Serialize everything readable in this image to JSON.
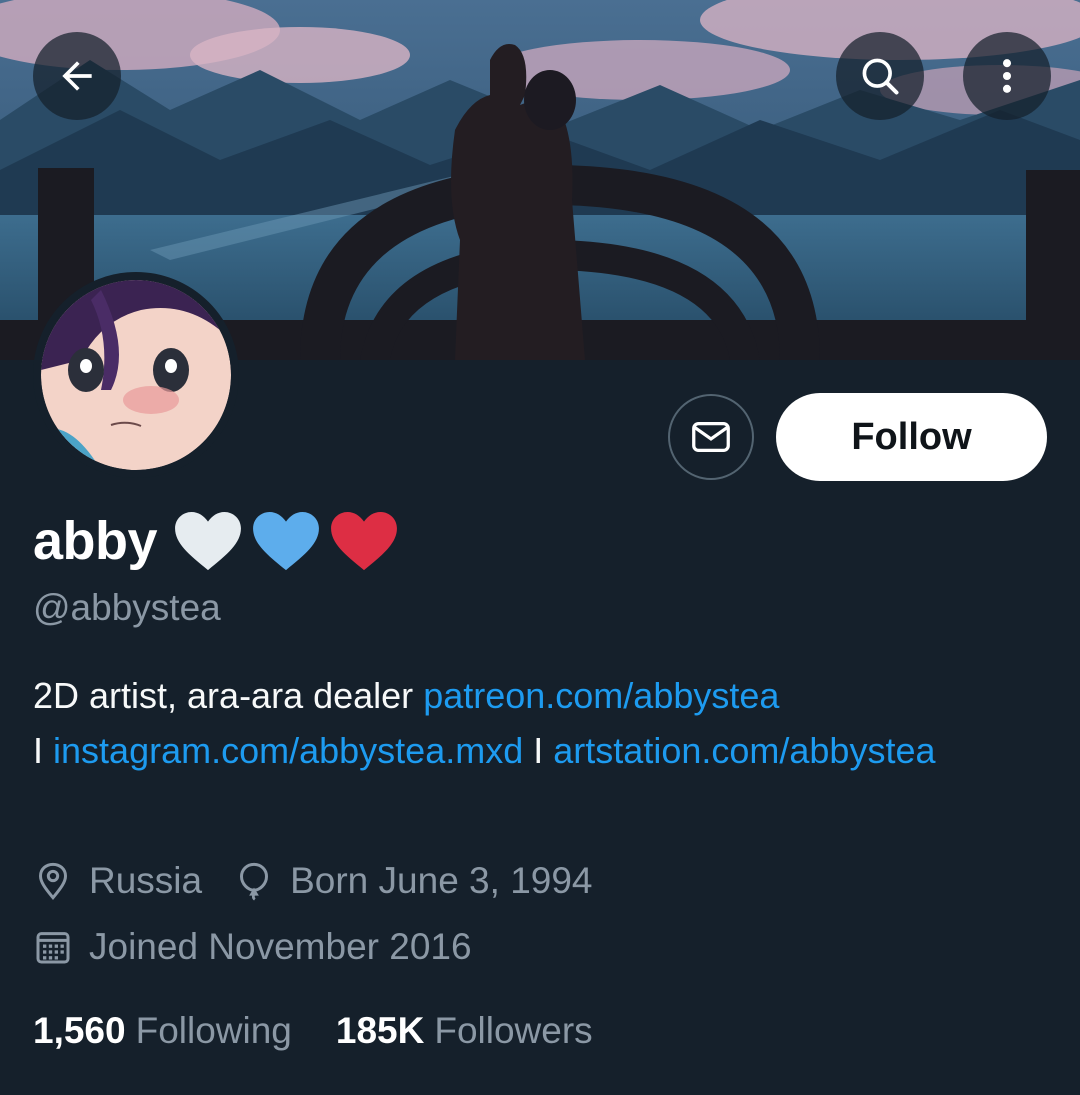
{
  "header": {
    "back_icon": "arrow-left-icon",
    "search_icon": "search-icon",
    "more_icon": "more-vertical-icon"
  },
  "profile": {
    "display_name": "abby",
    "name_emojis": [
      "white-heart",
      "blue-heart",
      "red-heart"
    ],
    "handle": "@abbystea",
    "follow_label": "Follow",
    "message_icon": "envelope-icon",
    "bio": {
      "text": "2D artist, ara-ara dealer",
      "link1": "patreon.com/abbystea",
      "separator1": "I",
      "link2": "instagram.com/abbystea.mxd",
      "separator2": "I",
      "link3": "artstation.com/abbystea"
    },
    "location": "Russia",
    "birthday": "Born June 3, 1994",
    "joined": "Joined November 2016",
    "following_count": "1,560",
    "following_label": "Following",
    "followers_count": "185K",
    "followers_label": "Followers"
  },
  "colors": {
    "background": "#15202b",
    "link": "#1d9bf0",
    "secondary_text": "#8b98a5",
    "heart_white": "#e6ecf0",
    "heart_blue": "#5dadec",
    "heart_red": "#dd2e44"
  }
}
